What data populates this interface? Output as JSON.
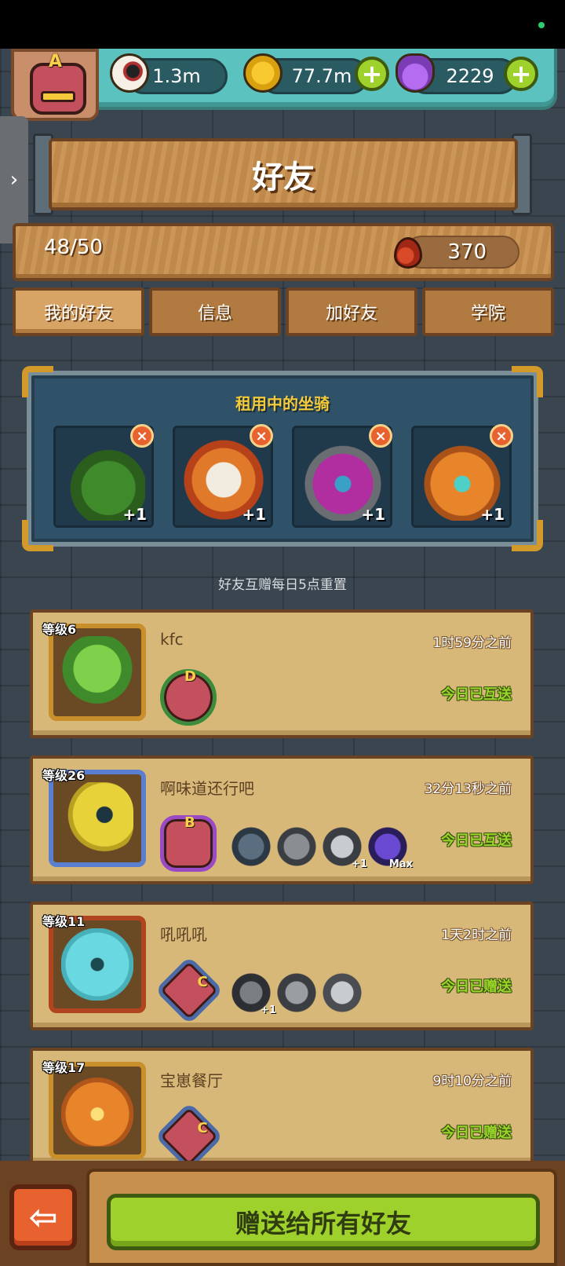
{
  "top_bar": {
    "rank": "A",
    "eyes": "1.3m",
    "coins": "77.7m",
    "potions": "2229",
    "plus": "+",
    "side_tab_icon": "›"
  },
  "header": {
    "title": "好友"
  },
  "stats": {
    "friend_count": "48/50",
    "blood": "370"
  },
  "tabs": [
    {
      "label": "我的好友",
      "active": true
    },
    {
      "label": "信息"
    },
    {
      "label": "加好友"
    },
    {
      "label": "学院"
    }
  ],
  "mounts": {
    "title": "租用中的坐骑",
    "items": [
      {
        "name": "christmas-tree-monster",
        "tag": "+1",
        "close": "×"
      },
      {
        "name": "lion-dance-monster",
        "tag": "+1",
        "close": "×"
      },
      {
        "name": "purple-horned-monster",
        "tag": "+1",
        "close": "×"
      },
      {
        "name": "pumpkin-robot-monster",
        "tag": "+1",
        "close": "×"
      }
    ]
  },
  "reset_note": "好友互赠每日5点重置",
  "friends": [
    {
      "level": "等级6",
      "name": "kfc",
      "time": "1时59分之前",
      "status": "今日已互送",
      "badge_rank": "D",
      "minis": []
    },
    {
      "level": "等级26",
      "name": "啊味道还行吧",
      "time": "32分13秒之前",
      "status": "今日已互送",
      "badge_rank": "B",
      "minis": [
        {
          "tag": ""
        },
        {
          "tag": ""
        },
        {
          "tag": "+1"
        },
        {
          "tag": "Max"
        }
      ]
    },
    {
      "level": "等级11",
      "name": "吼吼吼",
      "time": "1天2时之前",
      "status": "今日已赠送",
      "badge_rank": "C",
      "minis": [
        {
          "tag": "+1"
        },
        {
          "tag": ""
        },
        {
          "tag": ""
        }
      ]
    },
    {
      "level": "等级17",
      "name": "宝崽餐厅",
      "time": "9时10分之前",
      "status": "今日已赠送",
      "badge_rank": "C",
      "minis": []
    }
  ],
  "bottom": {
    "back_icon": "⇦",
    "gift_all_label": "赠送给所有好友"
  },
  "colors": {
    "accent_green": "#9fd12c",
    "wood": "#c8904e",
    "panel_blue": "#2f5268",
    "close_orange": "#e8622f"
  }
}
